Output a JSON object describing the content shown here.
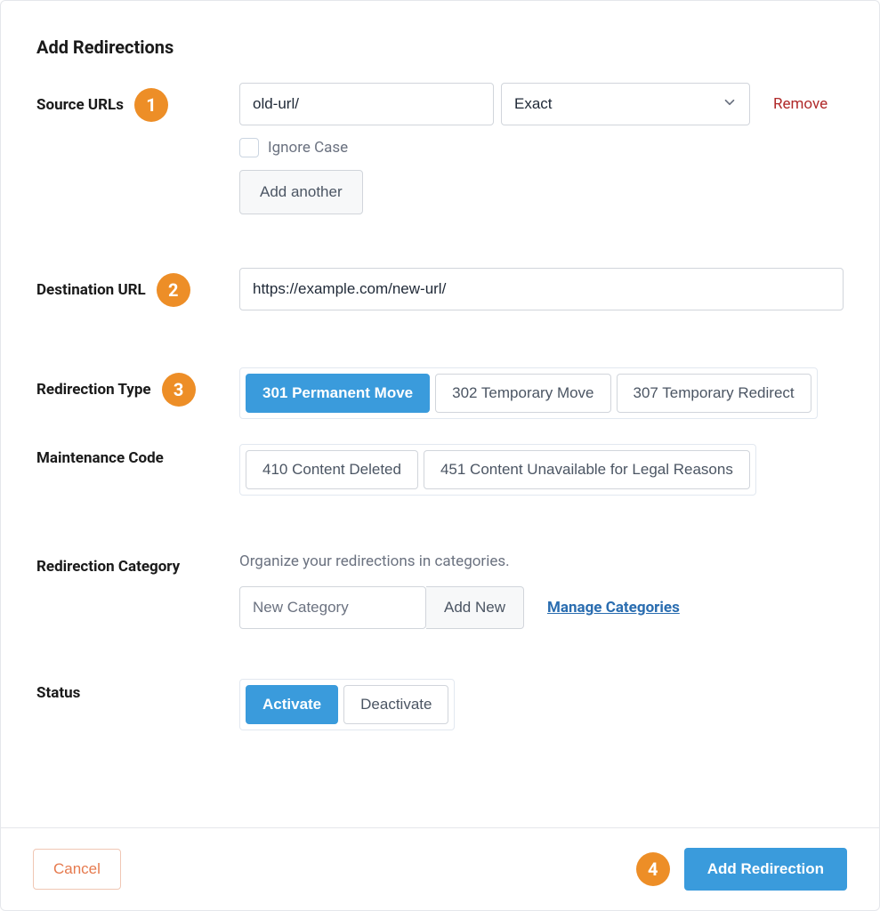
{
  "title": "Add Redirections",
  "annotations": {
    "a1": "1",
    "a2": "2",
    "a3": "3",
    "a4": "4"
  },
  "source": {
    "label": "Source URLs",
    "url_value": "old-url/",
    "match": {
      "selected": "Exact"
    },
    "remove": "Remove",
    "ignore_case": {
      "label": "Ignore Case",
      "checked": false
    },
    "add_another": "Add another"
  },
  "destination": {
    "label": "Destination URL",
    "value": "https://example.com/new-url/"
  },
  "redirection_type": {
    "label": "Redirection Type",
    "options": [
      {
        "label": "301 Permanent Move",
        "active": true
      },
      {
        "label": "302 Temporary Move",
        "active": false
      },
      {
        "label": "307 Temporary Redirect",
        "active": false
      }
    ]
  },
  "maintenance": {
    "label": "Maintenance Code",
    "options": [
      {
        "label": "410 Content Deleted",
        "active": false
      },
      {
        "label": "451 Content Unavailable for Legal Reasons",
        "active": false
      }
    ]
  },
  "category": {
    "label": "Redirection Category",
    "help": "Organize your redirections in categories.",
    "placeholder": "New Category",
    "add_new": "Add New",
    "manage": "Manage Categories"
  },
  "status": {
    "label": "Status",
    "options": [
      {
        "label": "Activate",
        "active": true
      },
      {
        "label": "Deactivate",
        "active": false
      }
    ]
  },
  "footer": {
    "cancel": "Cancel",
    "submit": "Add Redirection"
  }
}
